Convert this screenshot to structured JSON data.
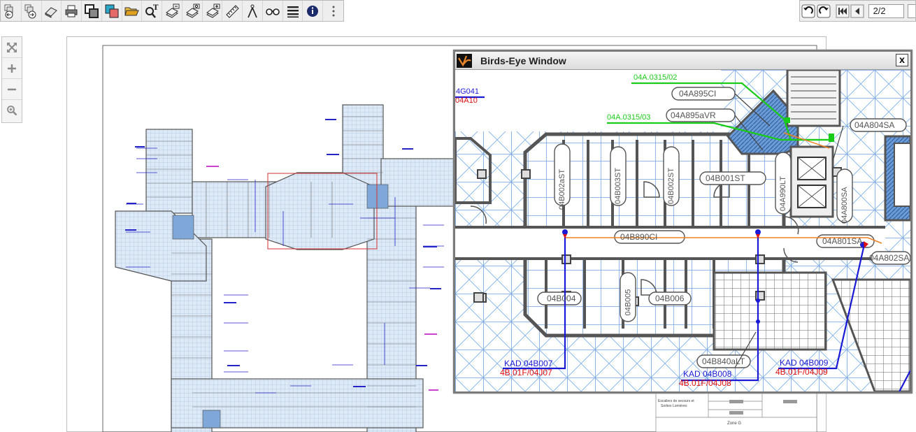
{
  "toolbar": {
    "buttons": [
      {
        "name": "back-forward-icon"
      },
      {
        "name": "forward-history-icon"
      },
      {
        "name": "eraser-icon"
      },
      {
        "name": "print-icon"
      },
      {
        "name": "copy-window-icon"
      },
      {
        "name": "layers-window-icon"
      },
      {
        "name": "open-folder-icon"
      },
      {
        "name": "text-search-icon"
      },
      {
        "name": "layer-minus-icon"
      },
      {
        "name": "layer-settings-icon"
      },
      {
        "name": "layer-plus-icon"
      },
      {
        "name": "measure-ruler-icon"
      },
      {
        "name": "compass-icon"
      },
      {
        "name": "binoculars-icon"
      },
      {
        "name": "list-icon"
      },
      {
        "name": "info-icon"
      },
      {
        "name": "more-vertical-icon"
      }
    ]
  },
  "pager": {
    "current_page": "2/2"
  },
  "zoom_controls": [
    "fit-extents-icon",
    "zoom-in-icon",
    "zoom-out-icon",
    "zoom-window-icon"
  ],
  "colors": {
    "accent_blue": "#1e1ec8",
    "accent_red": "#e01010",
    "accent_green": "#10d010",
    "plan_blue": "#8ab6e8"
  },
  "title_block": {
    "lines": [
      "Escaliers de secours et",
      "Sorties Lomières"
    ],
    "zone": "Zone G"
  },
  "birds_eye": {
    "title": "Birds-Eye Window",
    "close_label": "x",
    "labels": {
      "g041": "4G041",
      "a10": "04A10",
      "a0315_02": "04A.0315/02",
      "a0315_03": "04A.0315/03",
      "a895ci": "04A895CI",
      "a895avr": "04A895aVR",
      "a804sa": "04A804SA",
      "b002ast": "04B002aST",
      "b003st": "04B003ST",
      "b002st": "04B002ST",
      "b001st": "04B001ST",
      "a990lt": "04A990LT",
      "a800sa": "04A800SA",
      "b890ci": "04B890CI",
      "a801sa": "04A801SA",
      "a802sa": "04A802SA",
      "b004": "04B004",
      "b005": "04B005",
      "b006": "04B006",
      "b840alt": "04B840aLT",
      "kad_b007": "KAD 04B007",
      "f07": "4B.01F/04J07",
      "kad_b008": "KAD 04B008",
      "f08": "4B.01F/04J08",
      "kad_b009": "KAD 04B009",
      "f09": "4B.01F/04J09"
    }
  }
}
